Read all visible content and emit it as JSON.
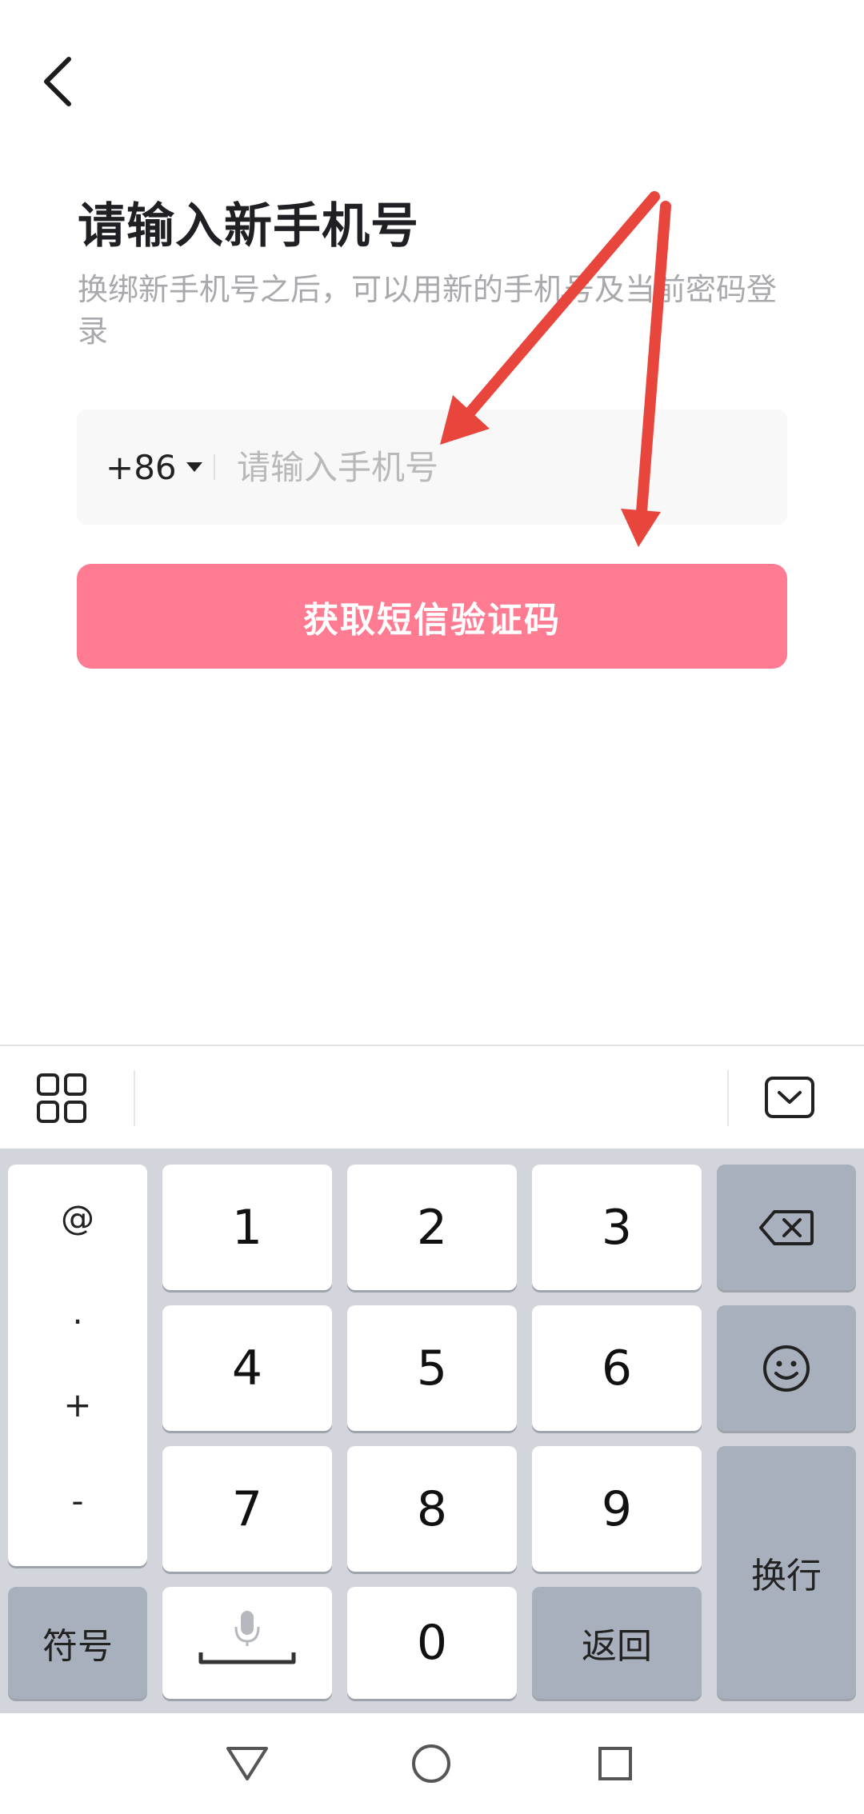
{
  "header": {
    "title": "请输入新手机号",
    "subtitle": "换绑新手机号之后，可以用新的手机号及当前密码登录"
  },
  "phone": {
    "country_code": "+86",
    "placeholder": "请输入手机号",
    "value": ""
  },
  "actions": {
    "sms_button": "获取短信验证码"
  },
  "colors": {
    "accent": "#ff7b91",
    "annotation_arrow": "#e8453c"
  },
  "keyboard": {
    "symbols": [
      "@",
      ".",
      "+",
      "-"
    ],
    "digits": [
      "1",
      "2",
      "3",
      "4",
      "5",
      "6",
      "7",
      "8",
      "9",
      "0"
    ],
    "symbol_key": "符号",
    "return_key": "返回",
    "enter_key": "换行",
    "toolbar": {
      "left_icon": "grid-icon",
      "right_icon": "keyboard-hide-icon"
    },
    "icons": {
      "backspace": "backspace-icon",
      "emoji": "emoji-icon",
      "voice": "mic-space-icon"
    }
  },
  "navbar": {
    "icons": [
      "back-triangle-icon",
      "home-circle-icon",
      "recents-square-icon"
    ]
  }
}
